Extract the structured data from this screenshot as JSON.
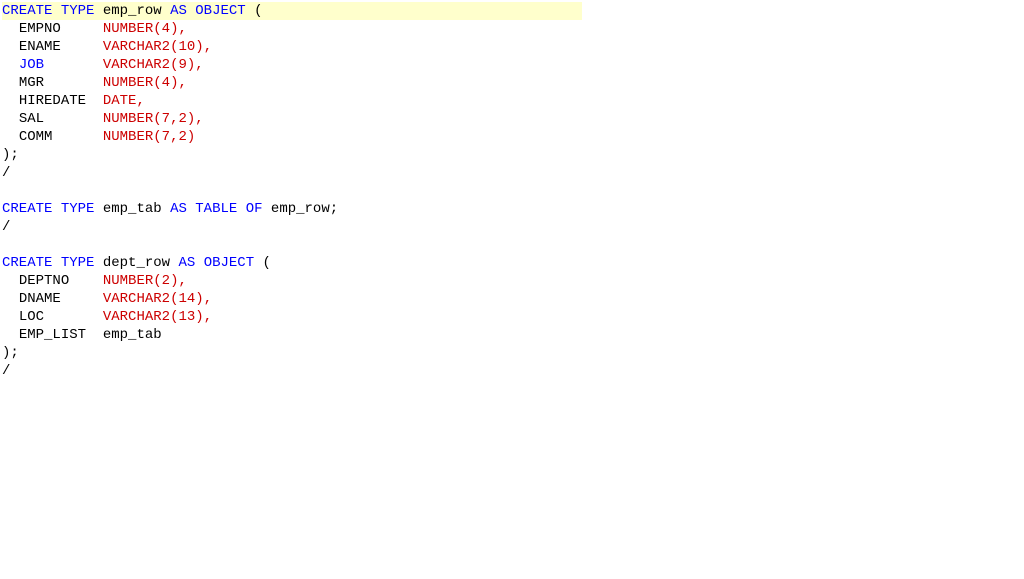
{
  "lines": [
    {
      "hl": true,
      "tokens": [
        {
          "c": "kw",
          "t": "CREATE"
        },
        {
          "c": "txt",
          "t": " "
        },
        {
          "c": "kw",
          "t": "TYPE"
        },
        {
          "c": "txt",
          "t": " "
        },
        {
          "c": "id",
          "t": "emp_row"
        },
        {
          "c": "txt",
          "t": " "
        },
        {
          "c": "kw",
          "t": "AS"
        },
        {
          "c": "txt",
          "t": " "
        },
        {
          "c": "kw",
          "t": "OBJECT"
        },
        {
          "c": "txt",
          "t": " "
        },
        {
          "c": "pn2",
          "t": "("
        }
      ]
    },
    {
      "tokens": [
        {
          "c": "txt",
          "t": "  "
        },
        {
          "c": "id",
          "t": "EMPNO"
        },
        {
          "c": "txt",
          "t": "     "
        },
        {
          "c": "dt",
          "t": "NUMBER"
        },
        {
          "c": "pn",
          "t": "("
        },
        {
          "c": "num",
          "t": "4"
        },
        {
          "c": "pn",
          "t": ")"
        },
        {
          "c": "pn",
          "t": ","
        }
      ]
    },
    {
      "tokens": [
        {
          "c": "txt",
          "t": "  "
        },
        {
          "c": "id",
          "t": "ENAME"
        },
        {
          "c": "txt",
          "t": "     "
        },
        {
          "c": "dt",
          "t": "VARCHAR2"
        },
        {
          "c": "pn",
          "t": "("
        },
        {
          "c": "num",
          "t": "10"
        },
        {
          "c": "pn",
          "t": ")"
        },
        {
          "c": "pn",
          "t": ","
        }
      ]
    },
    {
      "tokens": [
        {
          "c": "txt",
          "t": "  "
        },
        {
          "c": "kw",
          "t": "JOB"
        },
        {
          "c": "txt",
          "t": "       "
        },
        {
          "c": "dt",
          "t": "VARCHAR2"
        },
        {
          "c": "pn",
          "t": "("
        },
        {
          "c": "num",
          "t": "9"
        },
        {
          "c": "pn",
          "t": ")"
        },
        {
          "c": "pn",
          "t": ","
        }
      ]
    },
    {
      "tokens": [
        {
          "c": "txt",
          "t": "  "
        },
        {
          "c": "id",
          "t": "MGR"
        },
        {
          "c": "txt",
          "t": "       "
        },
        {
          "c": "dt",
          "t": "NUMBER"
        },
        {
          "c": "pn",
          "t": "("
        },
        {
          "c": "num",
          "t": "4"
        },
        {
          "c": "pn",
          "t": ")"
        },
        {
          "c": "pn",
          "t": ","
        }
      ]
    },
    {
      "tokens": [
        {
          "c": "txt",
          "t": "  "
        },
        {
          "c": "id",
          "t": "HIREDATE"
        },
        {
          "c": "txt",
          "t": "  "
        },
        {
          "c": "dt",
          "t": "DATE"
        },
        {
          "c": "pn",
          "t": ","
        }
      ]
    },
    {
      "tokens": [
        {
          "c": "txt",
          "t": "  "
        },
        {
          "c": "id",
          "t": "SAL"
        },
        {
          "c": "txt",
          "t": "       "
        },
        {
          "c": "dt",
          "t": "NUMBER"
        },
        {
          "c": "pn",
          "t": "("
        },
        {
          "c": "num",
          "t": "7"
        },
        {
          "c": "pn",
          "t": ","
        },
        {
          "c": "num",
          "t": "2"
        },
        {
          "c": "pn",
          "t": ")"
        },
        {
          "c": "pn",
          "t": ","
        }
      ]
    },
    {
      "tokens": [
        {
          "c": "txt",
          "t": "  "
        },
        {
          "c": "id",
          "t": "COMM"
        },
        {
          "c": "txt",
          "t": "      "
        },
        {
          "c": "dt",
          "t": "NUMBER"
        },
        {
          "c": "pn",
          "t": "("
        },
        {
          "c": "num",
          "t": "7"
        },
        {
          "c": "pn",
          "t": ","
        },
        {
          "c": "num",
          "t": "2"
        },
        {
          "c": "pn",
          "t": ")"
        }
      ]
    },
    {
      "tokens": [
        {
          "c": "pn2",
          "t": ")"
        },
        {
          "c": "semi",
          "t": ";"
        }
      ]
    },
    {
      "tokens": [
        {
          "c": "txt",
          "t": "/"
        }
      ]
    },
    {
      "tokens": [
        {
          "c": "txt",
          "t": " "
        }
      ]
    },
    {
      "tokens": [
        {
          "c": "kw",
          "t": "CREATE"
        },
        {
          "c": "txt",
          "t": " "
        },
        {
          "c": "kw",
          "t": "TYPE"
        },
        {
          "c": "txt",
          "t": " "
        },
        {
          "c": "id",
          "t": "emp_tab"
        },
        {
          "c": "txt",
          "t": " "
        },
        {
          "c": "kw",
          "t": "AS"
        },
        {
          "c": "txt",
          "t": " "
        },
        {
          "c": "kw",
          "t": "TABLE"
        },
        {
          "c": "txt",
          "t": " "
        },
        {
          "c": "kw",
          "t": "OF"
        },
        {
          "c": "txt",
          "t": " "
        },
        {
          "c": "id",
          "t": "emp_row"
        },
        {
          "c": "semi",
          "t": ";"
        }
      ]
    },
    {
      "tokens": [
        {
          "c": "txt",
          "t": "/"
        }
      ]
    },
    {
      "tokens": [
        {
          "c": "txt",
          "t": " "
        }
      ]
    },
    {
      "tokens": [
        {
          "c": "kw",
          "t": "CREATE"
        },
        {
          "c": "txt",
          "t": " "
        },
        {
          "c": "kw",
          "t": "TYPE"
        },
        {
          "c": "txt",
          "t": " "
        },
        {
          "c": "id",
          "t": "dept_row"
        },
        {
          "c": "txt",
          "t": " "
        },
        {
          "c": "kw",
          "t": "AS"
        },
        {
          "c": "txt",
          "t": " "
        },
        {
          "c": "kw",
          "t": "OBJECT"
        },
        {
          "c": "txt",
          "t": " "
        },
        {
          "c": "pn2",
          "t": "("
        }
      ]
    },
    {
      "tokens": [
        {
          "c": "txt",
          "t": "  "
        },
        {
          "c": "id",
          "t": "DEPTNO"
        },
        {
          "c": "txt",
          "t": "    "
        },
        {
          "c": "dt",
          "t": "NUMBER"
        },
        {
          "c": "pn",
          "t": "("
        },
        {
          "c": "num",
          "t": "2"
        },
        {
          "c": "pn",
          "t": ")"
        },
        {
          "c": "pn",
          "t": ","
        }
      ]
    },
    {
      "tokens": [
        {
          "c": "txt",
          "t": "  "
        },
        {
          "c": "id",
          "t": "DNAME"
        },
        {
          "c": "txt",
          "t": "     "
        },
        {
          "c": "dt",
          "t": "VARCHAR2"
        },
        {
          "c": "pn",
          "t": "("
        },
        {
          "c": "num",
          "t": "14"
        },
        {
          "c": "pn",
          "t": ")"
        },
        {
          "c": "pn",
          "t": ","
        }
      ]
    },
    {
      "tokens": [
        {
          "c": "txt",
          "t": "  "
        },
        {
          "c": "id",
          "t": "LOC"
        },
        {
          "c": "txt",
          "t": "       "
        },
        {
          "c": "dt",
          "t": "VARCHAR2"
        },
        {
          "c": "pn",
          "t": "("
        },
        {
          "c": "num",
          "t": "13"
        },
        {
          "c": "pn",
          "t": ")"
        },
        {
          "c": "pn",
          "t": ","
        }
      ]
    },
    {
      "tokens": [
        {
          "c": "txt",
          "t": "  "
        },
        {
          "c": "id",
          "t": "EMP_LIST"
        },
        {
          "c": "txt",
          "t": "  "
        },
        {
          "c": "id",
          "t": "emp_tab"
        }
      ]
    },
    {
      "tokens": [
        {
          "c": "pn2",
          "t": ")"
        },
        {
          "c": "semi",
          "t": ";"
        }
      ]
    },
    {
      "tokens": [
        {
          "c": "txt",
          "t": "/"
        }
      ]
    }
  ]
}
